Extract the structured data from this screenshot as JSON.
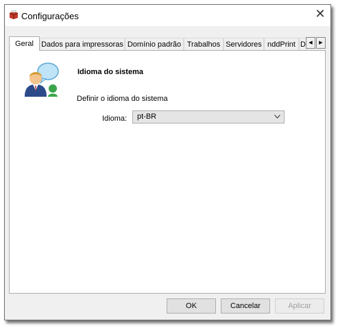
{
  "window": {
    "title": "Configurações",
    "close_glyph": "✕",
    "app_icon": "printer-red-icon"
  },
  "tabs": [
    {
      "label": "Geral",
      "active": true
    },
    {
      "label": "Dados para impressoras",
      "active": false
    },
    {
      "label": "Domínio padrão",
      "active": false
    },
    {
      "label": "Trabalhos",
      "active": false
    },
    {
      "label": "Servidores",
      "active": false
    },
    {
      "label": "nddPrint",
      "active": false
    },
    {
      "label": "D",
      "active": false
    }
  ],
  "tab_scroll": {
    "left": "◀",
    "right": "▶"
  },
  "panel": {
    "icon": "user-speech-bubble-icon",
    "section_title": "Idioma do sistema",
    "description": "Definir o idioma do sistema",
    "language_label": "Idioma:",
    "language_value": "pt-BR"
  },
  "buttons": {
    "ok": "OK",
    "cancel": "Cancelar",
    "apply": "Aplicar"
  }
}
